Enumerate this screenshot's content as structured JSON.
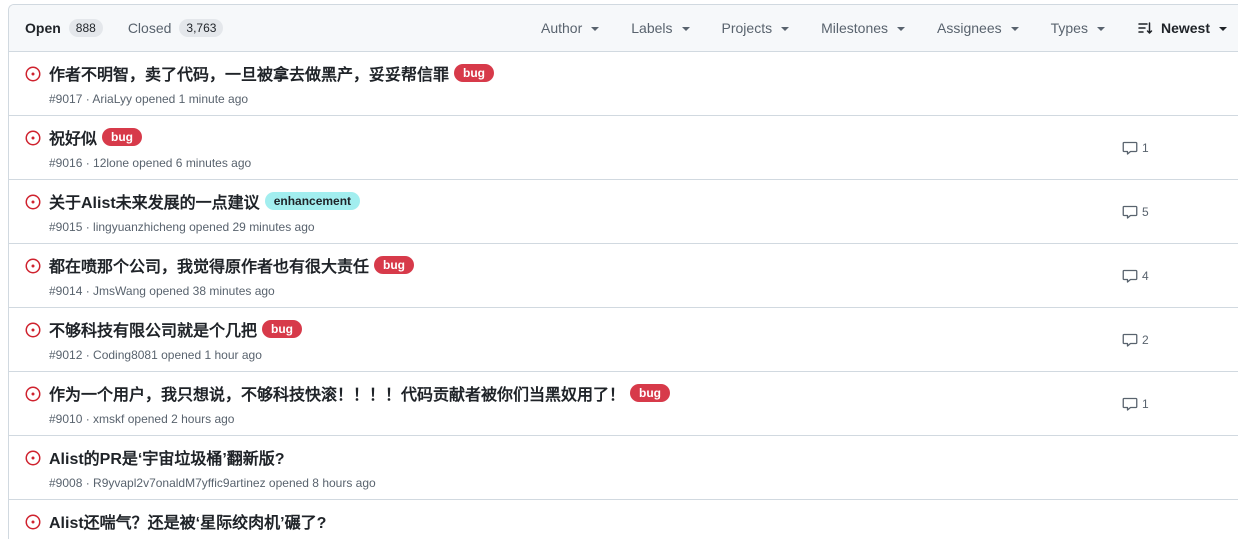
{
  "header": {
    "open_label": "Open",
    "open_count": "888",
    "closed_label": "Closed",
    "closed_count": "3,763",
    "filters": [
      "Author",
      "Labels",
      "Projects",
      "Milestones",
      "Assignees",
      "Types"
    ],
    "sort_label": "Newest"
  },
  "colors": {
    "open_icon": "#cf222e",
    "bug_bg": "#d73a4a",
    "bug_fg": "#ffffff",
    "enhancement_bg": "#a2eeef",
    "enhancement_fg": "#1f2328"
  },
  "issues": [
    {
      "title": "作者不明智，卖了代码，一旦被拿去做黑产，妥妥帮信罪",
      "label": "bug",
      "number": "#9017",
      "sep": " · ",
      "author": "AriaLyy",
      "opened": " opened 1 minute ago",
      "comments": ""
    },
    {
      "title": "祝好似",
      "label": "bug",
      "number": "#9016",
      "sep": " · ",
      "author": "12lone",
      "opened": " opened 6 minutes ago",
      "comments": "1"
    },
    {
      "title": "关于Alist未来发展的一点建议",
      "label": "enhancement",
      "number": "#9015",
      "sep": " · ",
      "author": "lingyuanzhicheng",
      "opened": " opened 29 minutes ago",
      "comments": "5"
    },
    {
      "title": "都在喷那个公司，我觉得原作者也有很大责任",
      "label": "bug",
      "number": "#9014",
      "sep": " · ",
      "author": "JmsWang",
      "opened": " opened 38 minutes ago",
      "comments": "4"
    },
    {
      "title": "不够科技有限公司就是个几把",
      "label": "bug",
      "number": "#9012",
      "sep": " · ",
      "author": "Coding8081",
      "opened": " opened 1 hour ago",
      "comments": "2"
    },
    {
      "title": "作为一个用户，我只想说，不够科技快滚！！！！代码贡献者被你们当黑奴用了！",
      "label": "bug",
      "number": "#9010",
      "sep": " · ",
      "author": "xmskf",
      "opened": " opened 2 hours ago",
      "comments": "1"
    },
    {
      "title": "Alist的PR是‘宇宙垃圾桶’翻新版?",
      "label": "",
      "number": "#9008",
      "sep": " · ",
      "author": "R9yvapl2v7onaldM7yffic9artinez",
      "opened": " opened 8 hours ago",
      "comments": ""
    },
    {
      "title": "Alist还喘气？还是被‘星际绞肉机’碾了?",
      "label": "",
      "number": "",
      "sep": "",
      "author": "",
      "opened": "",
      "comments": ""
    }
  ]
}
